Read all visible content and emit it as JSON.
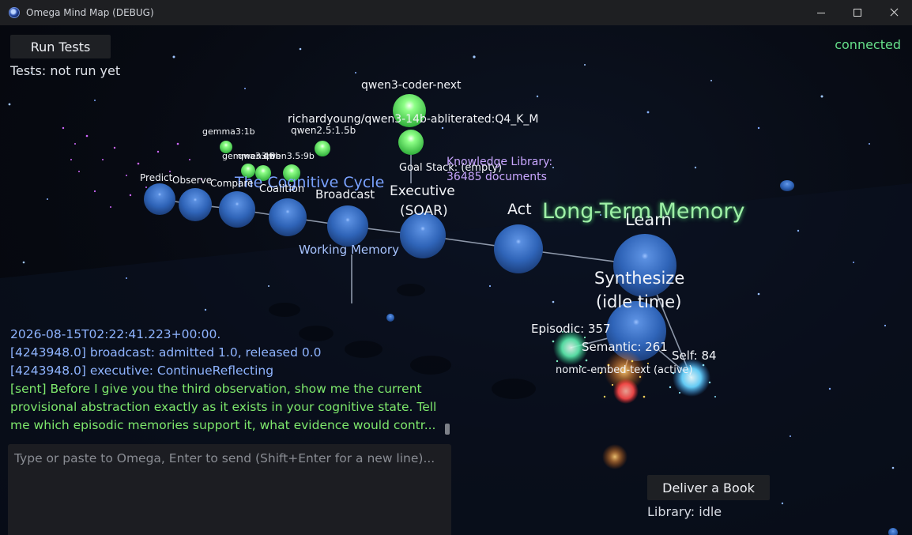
{
  "window": {
    "title": "Omega Mind Map (DEBUG)"
  },
  "controls": {
    "run_tests_label": "Run Tests",
    "tests_status": "Tests: not run yet",
    "connection_status": "connected"
  },
  "map": {
    "cycle_title": "The Cognitive Cycle",
    "nodes": {
      "predict": "Predict",
      "observe": "Observe",
      "compare": "Compare",
      "coalition": "Coalition",
      "broadcast": "Broadcast",
      "executive_line1": "Executive",
      "executive_line2": "(SOAR)",
      "act": "Act",
      "learn": "Learn",
      "synthesize_line1": "Synthesize",
      "synthesize_line2": "(idle time)"
    },
    "working_memory": "Working Memory",
    "goal_stack": "Goal Stack: (empty)",
    "knowledge_library_line1": "Knowledge Library:",
    "knowledge_library_line2": "36485 documents",
    "long_term_memory": "Long-Term Memory",
    "models": [
      "qwen3-coder-next",
      "richardyoung/qwen3-14b-abliterated:Q4_K_M",
      "qwen2.5:1.5b",
      "gemma3:1b",
      "gemma3:4b",
      "qwen3:8b",
      "qwen3.5:9b"
    ],
    "memory": {
      "episodic": "Episodic: 357",
      "semantic": "Semantic: 261",
      "self": "Self: 84",
      "embed": "nomic-embed-text (active)"
    }
  },
  "log": {
    "lines": [
      "2026-08-15T02:22:41.223+00:00.",
      "[4243948.0] broadcast: admitted 1.0, released 0.0",
      "[4243948.0] executive: ContinueReflecting"
    ],
    "sent_line1": "[sent] Before I give you the third observation, show me the current",
    "sent_line2": "provisional abstraction exactly as it exists in your cognitive state. Tell",
    "sent_line3": "me which episodic memories support it, what evidence would contr..."
  },
  "input": {
    "placeholder": "Type or paste to Omega, Enter to send (Shift+Enter for a new line)..."
  },
  "library": {
    "deliver_label": "Deliver a Book",
    "status": "Library: idle"
  },
  "colors": {
    "connected": "#66e08a",
    "cycle_title": "#7aa2ff",
    "long_term_memory": "#9ef0a6",
    "knowledge_library": "#c9a6ff",
    "node_blue": "#3a6fc4",
    "model_green": "#7cf07a"
  }
}
